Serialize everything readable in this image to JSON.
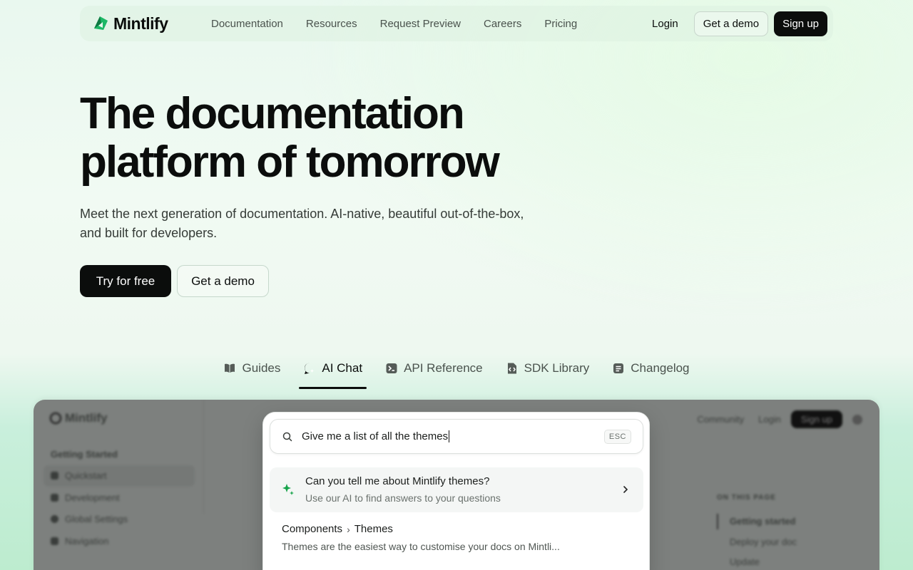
{
  "nav": {
    "brand": "Mintlify",
    "links": [
      "Documentation",
      "Resources",
      "Request Preview",
      "Careers",
      "Pricing"
    ],
    "login": "Login",
    "demo": "Get a demo",
    "signup": "Sign up"
  },
  "hero": {
    "title_line1": "The documentation",
    "title_line2": "platform of tomorrow",
    "subtitle": "Meet the next generation of documentation. AI-native, beautiful out-of-the-box, and built for developers.",
    "cta_primary": "Try for free",
    "cta_secondary": "Get a demo"
  },
  "tabs": [
    {
      "label": "Guides",
      "icon": "book-icon"
    },
    {
      "label": "AI Chat",
      "icon": "chat-icon",
      "active": true
    },
    {
      "label": "API Reference",
      "icon": "terminal-icon"
    },
    {
      "label": "SDK Library",
      "icon": "code-file-icon"
    },
    {
      "label": "Changelog",
      "icon": "list-icon"
    }
  ],
  "demo": {
    "brand": "Mintlify",
    "sidebar_title": "Getting Started",
    "sidebar_items": [
      "Quickstart",
      "Development",
      "Global Settings",
      "Navigation"
    ],
    "top_links": [
      "Community",
      "Login"
    ],
    "top_button": "Sign up",
    "toc_title": "ON THIS PAGE",
    "toc_items": [
      "Getting started",
      "Deploy your doc",
      "Update"
    ]
  },
  "search": {
    "query": "Give me a list of all the themes",
    "esc": "ESC",
    "ai_result": {
      "title": "Can you tell me about Mintlify themes?",
      "desc": "Use our AI to find answers to your questions"
    },
    "doc_result": {
      "crumb_parent": "Components",
      "crumb_child": "Themes",
      "desc": "Themes are the easiest way to customise your docs on Mintli..."
    }
  },
  "colors": {
    "accent": "#16a34a",
    "dark": "#0b0d0c"
  }
}
